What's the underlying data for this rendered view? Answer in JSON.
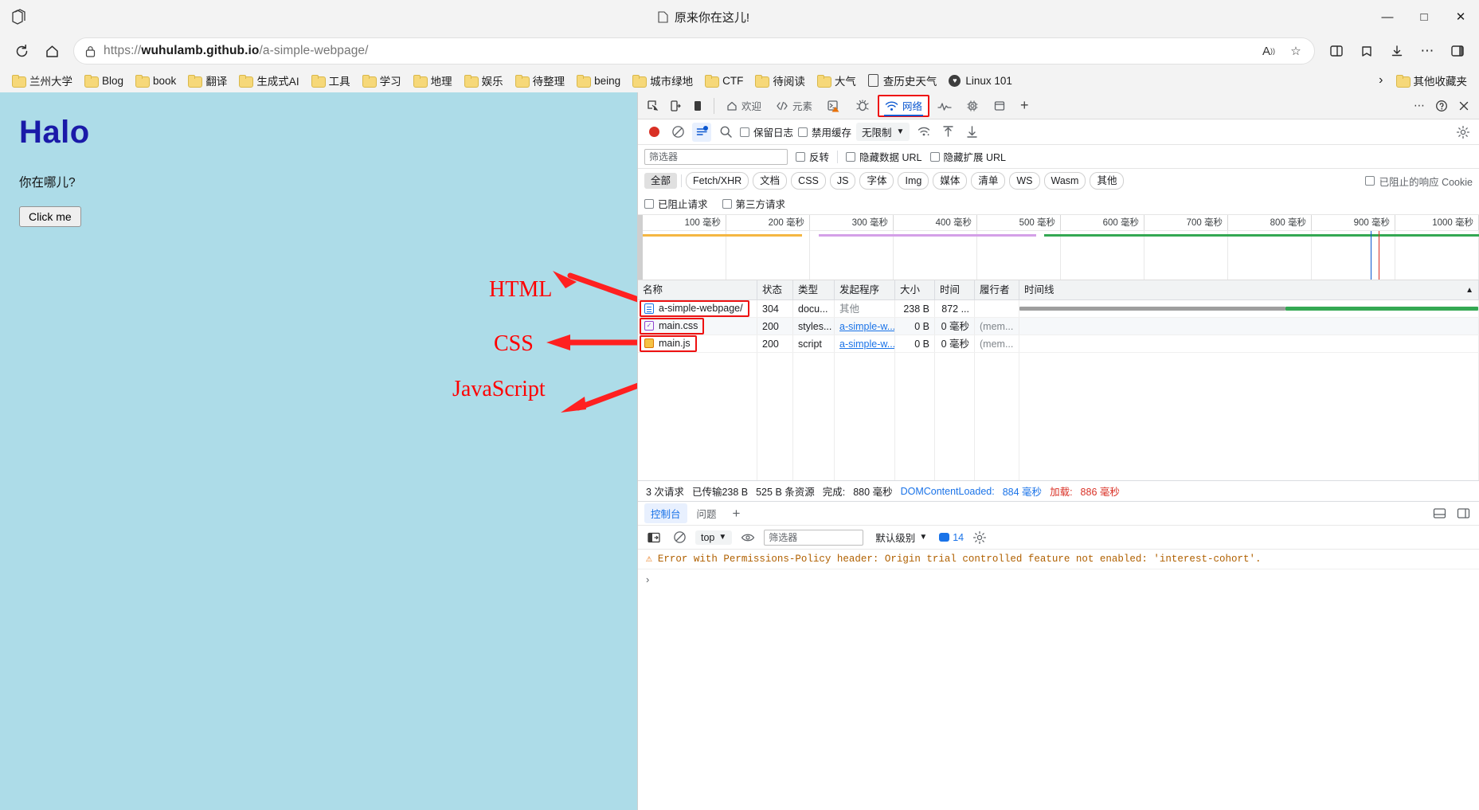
{
  "window": {
    "title": "原来你在这儿!",
    "doc_icon": "books-icon",
    "minimize": "—",
    "maximize": "□",
    "close": "✕"
  },
  "nav": {
    "reload_icon": "reload-icon",
    "home_icon": "home-icon",
    "lock_icon": "lock-icon",
    "url_scheme": "https://",
    "url_host": "wuhulamb.github.io",
    "url_path": "/a-simple-webpage/",
    "read_aloud_icon": "read-aloud-icon",
    "favorite_icon": "star-icon",
    "split_screen_icon": "split-screen-icon",
    "collections_icon": "collections-icon",
    "downloads_icon": "download-icon",
    "more_icon": "ellipsis-icon",
    "sidebar_icon": "sidebar-icon"
  },
  "bookmarks": {
    "items": [
      {
        "label": "兰州大学",
        "icon": "folder-icon"
      },
      {
        "label": "Blog",
        "icon": "folder-icon"
      },
      {
        "label": "book",
        "icon": "folder-icon"
      },
      {
        "label": "翻译",
        "icon": "folder-icon"
      },
      {
        "label": "生成式AI",
        "icon": "folder-icon"
      },
      {
        "label": "工具",
        "icon": "folder-icon"
      },
      {
        "label": "学习",
        "icon": "folder-icon"
      },
      {
        "label": "地理",
        "icon": "folder-icon"
      },
      {
        "label": "娱乐",
        "icon": "folder-icon"
      },
      {
        "label": "待整理",
        "icon": "folder-icon"
      },
      {
        "label": "being",
        "icon": "folder-icon"
      },
      {
        "label": "城市绿地",
        "icon": "folder-icon"
      },
      {
        "label": "CTF",
        "icon": "folder-icon"
      },
      {
        "label": "待阅读",
        "icon": "folder-icon"
      },
      {
        "label": "大气",
        "icon": "folder-icon"
      },
      {
        "label": "查历史天气",
        "icon": "page-icon"
      },
      {
        "label": "Linux 101",
        "icon": "circle-icon"
      }
    ],
    "overflow_chevron": "›",
    "other_favorites": {
      "label": "其他收藏夹",
      "icon": "folder-icon"
    }
  },
  "page": {
    "heading": "Halo",
    "paragraph": "你在哪儿?",
    "button": "Click me",
    "annotations": [
      {
        "label": "HTML"
      },
      {
        "label": "CSS"
      },
      {
        "label": "JavaScript"
      }
    ]
  },
  "devtools": {
    "left_icons": [
      "inspect-element-icon",
      "device-toolbar-icon",
      "dock-side-icon"
    ],
    "tabs": [
      {
        "label": "欢迎",
        "icon": "home-icon",
        "active": false
      },
      {
        "label": "元素",
        "icon": "code-icon",
        "active": false
      },
      {
        "label": "",
        "icon": "console-warning-icon",
        "active": false
      },
      {
        "label": "",
        "icon": "debugger-icon",
        "active": false
      },
      {
        "label": "网络",
        "icon": "network-icon",
        "active": true
      },
      {
        "label": "",
        "icon": "performance-icon",
        "active": false
      },
      {
        "label": "",
        "icon": "memory-icon",
        "active": false
      },
      {
        "label": "",
        "icon": "application-icon",
        "active": false
      }
    ],
    "add_tab": "+",
    "more_tabs_icon": "ellipsis-icon",
    "help_icon": "help-icon",
    "close_icon": "close-icon",
    "network_toolbar": {
      "record_icon": "record-stop-icon",
      "clear_icon": "clear-icon",
      "filter_toggle_icon": "filter-icon",
      "search_icon": "search-icon",
      "preserve_log": "保留日志",
      "disable_cache": "禁用缓存",
      "throttle_value": "无限制",
      "throttle_caret": "▼",
      "network_conditions_icon": "network-conditions-icon",
      "import_har_icon": "import-icon",
      "export_har_icon": "export-icon",
      "settings_icon": "gear-icon"
    },
    "filter_bar": {
      "filter_placeholder": "筛选器",
      "invert": "反转",
      "hide_data_urls": "隐藏数据 URL",
      "hide_extension_urls": "隐藏扩展 URL"
    },
    "resource_types": [
      "全部",
      "Fetch/XHR",
      "文档",
      "CSS",
      "JS",
      "字体",
      "Img",
      "媒体",
      "清单",
      "WS",
      "Wasm",
      "其他"
    ],
    "resource_types_active": "全部",
    "blocked_response_cookies": "已阻止的响应 Cookie",
    "extra_filters": [
      "已阻止请求",
      "第三方请求"
    ],
    "overview": {
      "ticks": [
        "100 毫秒",
        "200 毫秒",
        "300 毫秒",
        "400 毫秒",
        "500 毫秒",
        "600 毫秒",
        "700 毫秒",
        "800 毫秒",
        "900 毫秒",
        "1000 毫秒"
      ],
      "bands": [
        {
          "color": "#f5b642",
          "start_pct": 0,
          "end_pct": 19
        },
        {
          "color": "#d4a0e8",
          "start_pct": 21,
          "end_pct": 47
        },
        {
          "color": "#34a853",
          "start_pct": 48,
          "end_pct": 100
        }
      ],
      "markers": [
        {
          "color": "#0b57d0",
          "pos_pct": 87
        },
        {
          "color": "#d93025",
          "pos_pct": 88
        }
      ]
    },
    "table": {
      "columns": [
        "名称",
        "状态",
        "类型",
        "发起程序",
        "大小",
        "时间",
        "履行者",
        "时间线"
      ],
      "sort_caret": "▲",
      "rows": [
        {
          "name": "a-simple-webpage/",
          "icon": "document-icon",
          "highlighted": true,
          "status": "304",
          "type": "docu...",
          "initiator": "其他",
          "initiator_link": false,
          "size": "238 B",
          "time": "872 ...",
          "performer": "",
          "waterfall": {
            "color": "#9e9e9e",
            "start_pct": 0,
            "width_pct": 58
          }
        },
        {
          "name": "main.css",
          "icon": "stylesheet-icon",
          "highlighted": true,
          "status": "200",
          "type": "styles...",
          "initiator": "a-simple-w...",
          "initiator_link": true,
          "size": "0 B",
          "time": "0 毫秒",
          "performer": "(mem...",
          "waterfall": null
        },
        {
          "name": "main.js",
          "icon": "script-icon",
          "highlighted": true,
          "status": "200",
          "type": "script",
          "initiator": "a-simple-w...",
          "initiator_link": true,
          "size": "0 B",
          "time": "0 毫秒",
          "performer": "(mem...",
          "waterfall": null
        }
      ]
    },
    "summary": {
      "requests": "3 次请求",
      "transferred": "已传输238 B",
      "resources": "525 B 条资源",
      "finish_label": "完成:",
      "finish_value": "880 毫秒",
      "dcl_label": "DOMContentLoaded:",
      "dcl_value": "884 毫秒",
      "load_label": "加载:",
      "load_value": "886 毫秒"
    },
    "drawer": {
      "tabs": [
        {
          "label": "控制台",
          "active": true
        },
        {
          "label": "问题",
          "active": false
        }
      ],
      "add_tab": "+",
      "right_icons": [
        "dock-bottom-icon",
        "dock-right-icon"
      ],
      "toolbar": {
        "sidebar_icon": "console-sidebar-icon",
        "clear_icon": "clear-icon",
        "context": "top",
        "context_caret": "▼",
        "eye_icon": "live-expression-icon",
        "filter_placeholder": "筛选器",
        "level": "默认级别",
        "level_caret": "▼",
        "issues_count": "14",
        "issues_icon": "issues-bubble-icon",
        "settings_icon": "gear-icon"
      },
      "messages": [
        {
          "level": "warning",
          "icon": "warning-triangle-icon",
          "text": "Error with Permissions-Policy header: Origin trial controlled feature not enabled: 'interest-cohort'."
        }
      ],
      "prompt": "›"
    }
  },
  "colors": {
    "accent_blue": "#1a73e8",
    "annotation_red": "#ff0000",
    "page_bg": "#addce8",
    "heading_blue": "#1a1aa8",
    "warn_orange": "#b06000"
  }
}
